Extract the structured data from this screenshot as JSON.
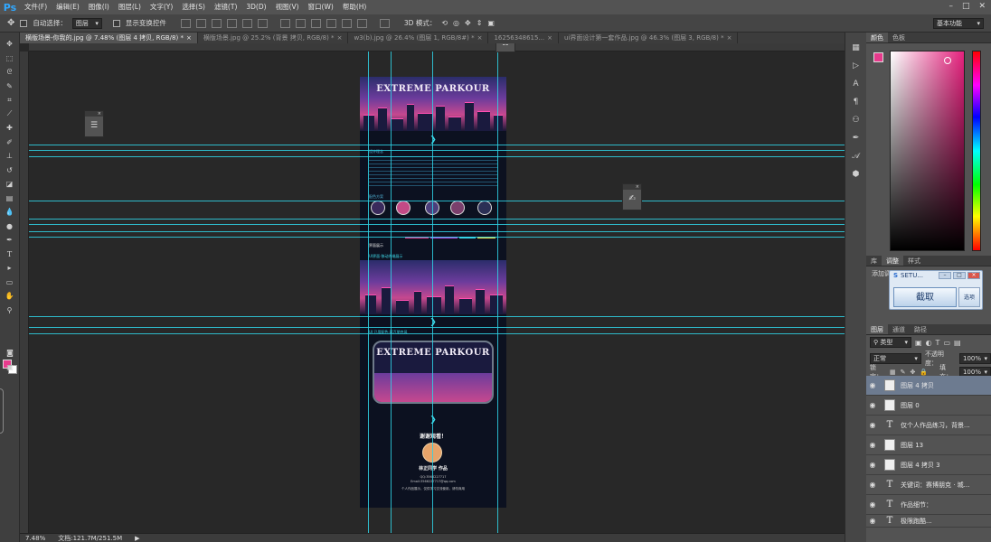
{
  "app": {
    "logo": "Ps",
    "menu": [
      "文件(F)",
      "编辑(E)",
      "图像(I)",
      "图层(L)",
      "文字(Y)",
      "选择(S)",
      "滤镜(T)",
      "3D(D)",
      "视图(V)",
      "窗口(W)",
      "帮助(H)"
    ],
    "window_controls": [
      "–",
      "□",
      "✕"
    ]
  },
  "options_bar": {
    "auto_select_label": "自动选择：",
    "auto_select_value": "图层",
    "show_transform_label": "显示变换控件",
    "mode_3d_label": "3D 模式：",
    "workspace": "基本功能"
  },
  "tabs": [
    {
      "label": "横版场景-你我的.jpg @ 7.48% (图层 4 拷贝, RGB/8) *",
      "active": true
    },
    {
      "label": "横版场景.jpg @ 25.2% (背景 拷贝, RGB/8) *",
      "active": false
    },
    {
      "label": "w3(b).jpg @ 26.4% (图层 1, RGB/8#) *",
      "active": false
    },
    {
      "label": "16256348615...",
      "active": false
    },
    {
      "label": "ui界面设计第一套作品.jpg @ 46.3% (图层 3, RGB/8) *",
      "active": false
    }
  ],
  "document": {
    "banner_title_1": "EXTREME PARKOUR",
    "banner_title_2": "EXTREME PARKOUR",
    "section_label_1": "设计理念",
    "section_label_2": "配色方案",
    "section_label_3": "界面展示",
    "section_label_4": "UI界面·移动终端展示",
    "section_label_5": "UI 已用配色·蒸汽朋克风",
    "thanks_text": "谢谢观看！",
    "author_text": "林正同学 作品",
    "qq_text": "QQ:3566227717",
    "email_text": "Email:3566227717@qq.com",
    "footer_text": "个人作品展示，仅供学习交流使用，请勿商用"
  },
  "status_bar": {
    "zoom": "7.48%",
    "doc_size": "文档:121.7M/251.5M"
  },
  "right_panel": {
    "color_tabs": [
      "颜色",
      "色板"
    ],
    "fg_color": "#e73a8c",
    "bg_color": "#ffffff",
    "adjust_tabs": [
      "库",
      "调整",
      "样式"
    ],
    "adjust_label": "添加调整",
    "layers_tabs": [
      "图层",
      "通道",
      "路径"
    ],
    "kind_filter": "类型",
    "blend_mode": "正常",
    "opacity_label": "不透明度：",
    "opacity_value": "100%",
    "lock_label": "锁定：",
    "fill_label": "填充：",
    "fill_value": "100%",
    "layers": [
      {
        "name": "图层 4 拷贝",
        "type": "pixel",
        "selected": true
      },
      {
        "name": "图层 0",
        "type": "pixel",
        "selected": false
      },
      {
        "name": "仅个人作品练习，背景...",
        "type": "text",
        "selected": false
      },
      {
        "name": "图层 13",
        "type": "pixel",
        "selected": false
      },
      {
        "name": "图层 4 拷贝 3",
        "type": "pixel",
        "selected": false
      },
      {
        "name": "关键词：赛博朋克 · 城...",
        "type": "text",
        "selected": false
      },
      {
        "name": "作品细节：",
        "type": "text",
        "selected": false
      },
      {
        "name": "极限跑酷...",
        "type": "text",
        "selected": false
      }
    ]
  },
  "setu_popup": {
    "title": "SETU...",
    "capture_label": "截取",
    "options_label": "选项"
  },
  "colors": {
    "accent_guides": "#2fd3e6",
    "brand_pink": "#e73a8c"
  }
}
